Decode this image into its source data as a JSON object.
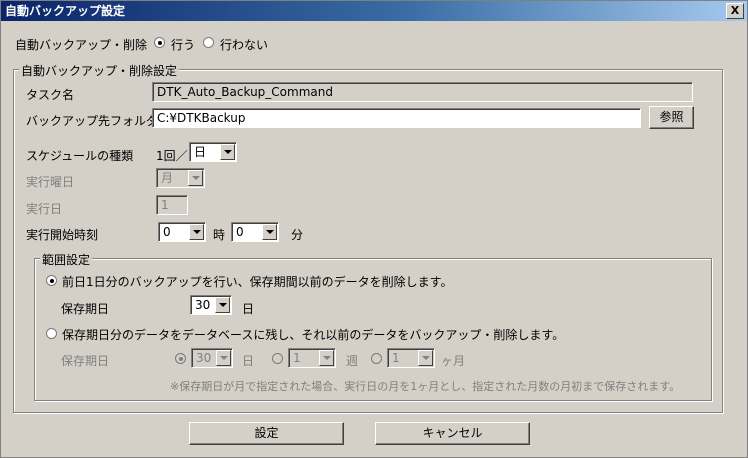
{
  "window": {
    "title": "自動バックアップ設定",
    "close_label": "X"
  },
  "auto_backup": {
    "label": "自動バックアップ・削除",
    "options": [
      {
        "label": "行う",
        "selected": true
      },
      {
        "label": "行わない",
        "selected": false
      }
    ]
  },
  "settings_group": {
    "legend": "自動バックアップ・削除設定",
    "task_name": {
      "label": "タスク名",
      "value": "DTK_Auto_Backup_Command"
    },
    "backup_folder": {
      "label": "バックアップ先フォルダ",
      "value": "C:¥DTKBackup",
      "browse_label": "参照"
    },
    "schedule_type": {
      "label": "スケジュールの種類",
      "prefix": "1回／",
      "value": "日"
    },
    "weekday": {
      "label": "実行曜日",
      "value": "月"
    },
    "day": {
      "label": "実行日",
      "value": "1"
    },
    "start_time": {
      "label": "実行開始時刻",
      "hour": "0",
      "hour_unit": "時",
      "minute": "0",
      "minute_unit": "分"
    }
  },
  "range_group": {
    "legend": "範囲設定",
    "option1": {
      "label": "前日1日分のバックアップを行い、保存期間以前のデータを削除します。",
      "selected": true
    },
    "retention1": {
      "label": "保存期日",
      "value": "30",
      "unit": "日"
    },
    "option2": {
      "label": "保存期日分のデータをデータベースに残し、それ以前のデータをバックアップ・削除します。",
      "selected": false
    },
    "retention2": {
      "label": "保存期日",
      "days_value": "30",
      "days_unit": "日",
      "weeks_value": "1",
      "weeks_unit": "週",
      "months_value": "1",
      "months_unit": "ヶ月"
    },
    "note": "※保存期日が月で指定された場合、実行日の月を1ヶ月とし、指定された月数の月初まで保存されます。"
  },
  "buttons": {
    "ok": "設定",
    "cancel": "キャンセル"
  }
}
